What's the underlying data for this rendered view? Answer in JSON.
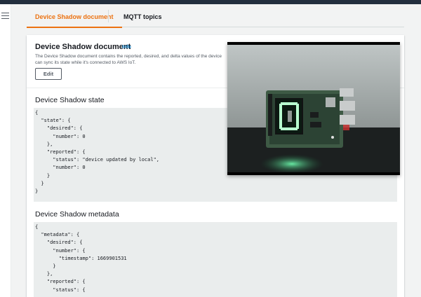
{
  "tabs": [
    {
      "label": "Device Shadow document",
      "active": true
    },
    {
      "label": "MQTT topics",
      "active": false
    }
  ],
  "card": {
    "title": "Device Shadow document",
    "info_link": "Info",
    "description_line1": "The Device Shadow document contains the reported, desired, and delta values of the device",
    "description_line2": "can sync its state while it's connected to AWS IoT.",
    "edit_button": "Edit"
  },
  "state_section": {
    "title": "Device Shadow state",
    "lines": [
      "{",
      "  \"state\": {",
      "    \"desired\": {",
      "      \"number\": 0",
      "    },",
      "    \"reported\": {",
      "      \"status\": \"device updated by local\",",
      "      \"number\": 0",
      "    }",
      "  }",
      "}"
    ]
  },
  "metadata_section": {
    "title": "Device Shadow metadata",
    "lines": [
      "{",
      "  \"metadata\": {",
      "    \"desired\": {",
      "      \"number\": {",
      "        \"timestamp\": 1669901531",
      "      }",
      "    },",
      "    \"reported\": {",
      "      \"status\": {"
    ]
  },
  "video": {
    "content": "camera-feed-raspberry-pi-led-matrix",
    "displayed_digit": "0"
  },
  "colors": {
    "accent": "#ec7211",
    "link": "#0073bb",
    "code_bg": "#eaeded",
    "led": "#b8ffd0"
  }
}
